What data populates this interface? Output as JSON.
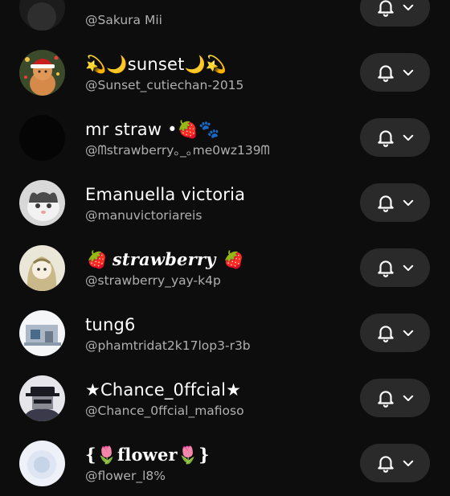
{
  "subscriptions": [
    {
      "name": "",
      "handle": "@Sakura Mii",
      "avatar": "dark-avatar"
    },
    {
      "name": "💫🌙sunset🌙💫",
      "handle": "@Sunset_cutiechan-2015",
      "avatar": "christmas-cat-avatar"
    },
    {
      "name": "mr straw •🍓🐾",
      "handle": "@ᗰstrawberry｡_｡me0wz139ᗰ",
      "avatar": "black-avatar"
    },
    {
      "name": "Emanuella victoria",
      "handle": "@manuvictoriareis",
      "avatar": "cat-avatar"
    },
    {
      "name": "🍓 strawberry 🍓",
      "handle": "@strawberry_yay-k4p",
      "avatar": "anime-girl-avatar"
    },
    {
      "name": "tung6",
      "handle": "@phamtridat2k17lop3-r3b",
      "avatar": "room-avatar"
    },
    {
      "name": "★Chance_0ffcial★",
      "handle": "@Chance_0ffcial_mafioso",
      "avatar": "gangster-avatar"
    },
    {
      "name": "{🌷flower🌷}",
      "handle": "@flower_l8%",
      "avatar": "white-character-avatar"
    }
  ],
  "icons": {
    "notification_button": "bell-icon",
    "dropdown": "chevron-down-icon"
  },
  "colors": {
    "background": "#0d0d0d",
    "button_background": "#2a2a2a",
    "handle_text": "#b0b0b0"
  }
}
